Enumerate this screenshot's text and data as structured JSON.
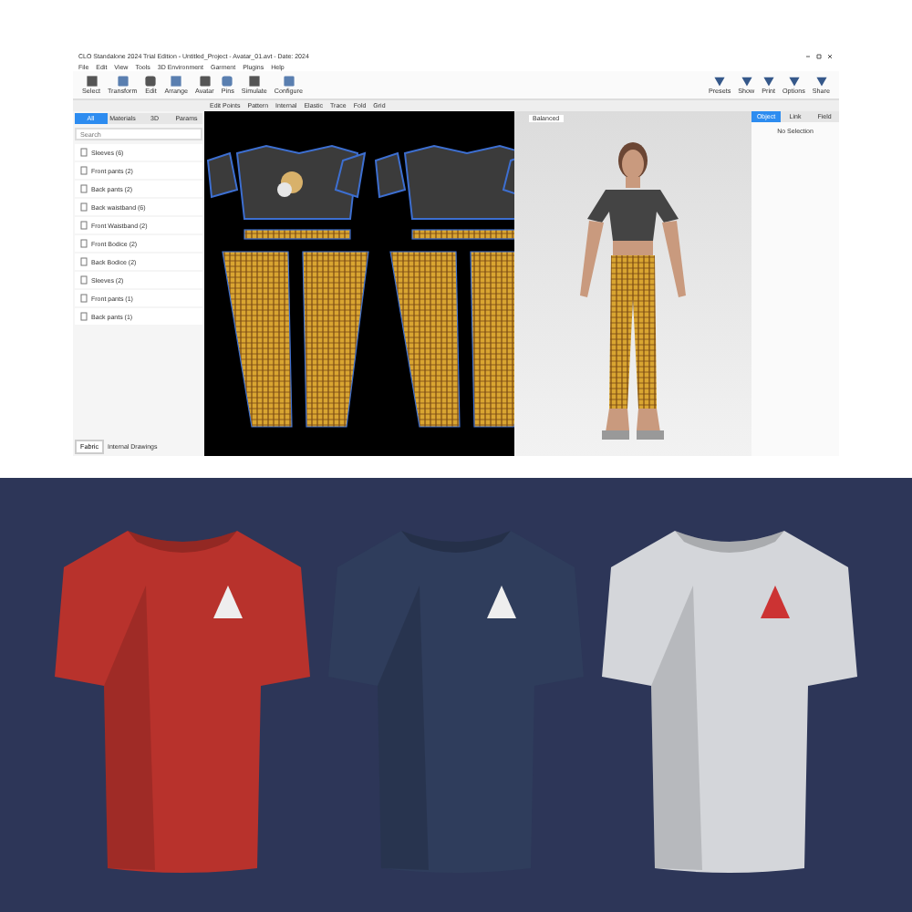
{
  "window": {
    "title": "CLO Standalone 2024 Trial Edition - Untitled_Project - Avatar_01.avt - Date: 2024"
  },
  "menu": [
    "File",
    "Edit",
    "View",
    "Tools",
    "3D Environment",
    "Garment",
    "Plugins",
    "Help"
  ],
  "toolbar": {
    "left": [
      "Select",
      "Transform",
      "Edit",
      "Arrange",
      "Avatar",
      "Pins",
      "Simulate",
      "Configure"
    ],
    "right": [
      "Presets",
      "Show",
      "Print",
      "Options",
      "Share"
    ]
  },
  "pattern_toolbar": [
    "Edit Points",
    "Pattern",
    "Internal",
    "Elastic",
    "Trace",
    "Fold",
    "Grid"
  ],
  "left_panel": {
    "tabs": [
      {
        "label": "All",
        "selected": true
      },
      {
        "label": "Materials",
        "selected": false
      },
      {
        "label": "3D",
        "selected": false
      },
      {
        "label": "Params",
        "selected": false
      }
    ],
    "search": {
      "placeholder": "Search"
    },
    "items": [
      "Sleeves (6)",
      "Front pants (2)",
      "Back pants (2)",
      "Back waistband (6)",
      "Front Waistband (2)",
      "Front Bodice (2)",
      "Back Bodice (2)",
      "Sleeves (2)",
      "Front pants (1)",
      "Back pants (1)"
    ],
    "footer": {
      "button": "Fabric",
      "label": "Internal Drawings"
    }
  },
  "view_3d": {
    "preset": "Balanced"
  },
  "right_panel": {
    "tabs": [
      {
        "label": "Object",
        "selected": true
      },
      {
        "label": "Link",
        "selected": false
      },
      {
        "label": "Field",
        "selected": false
      }
    ],
    "status": "No Selection"
  }
}
